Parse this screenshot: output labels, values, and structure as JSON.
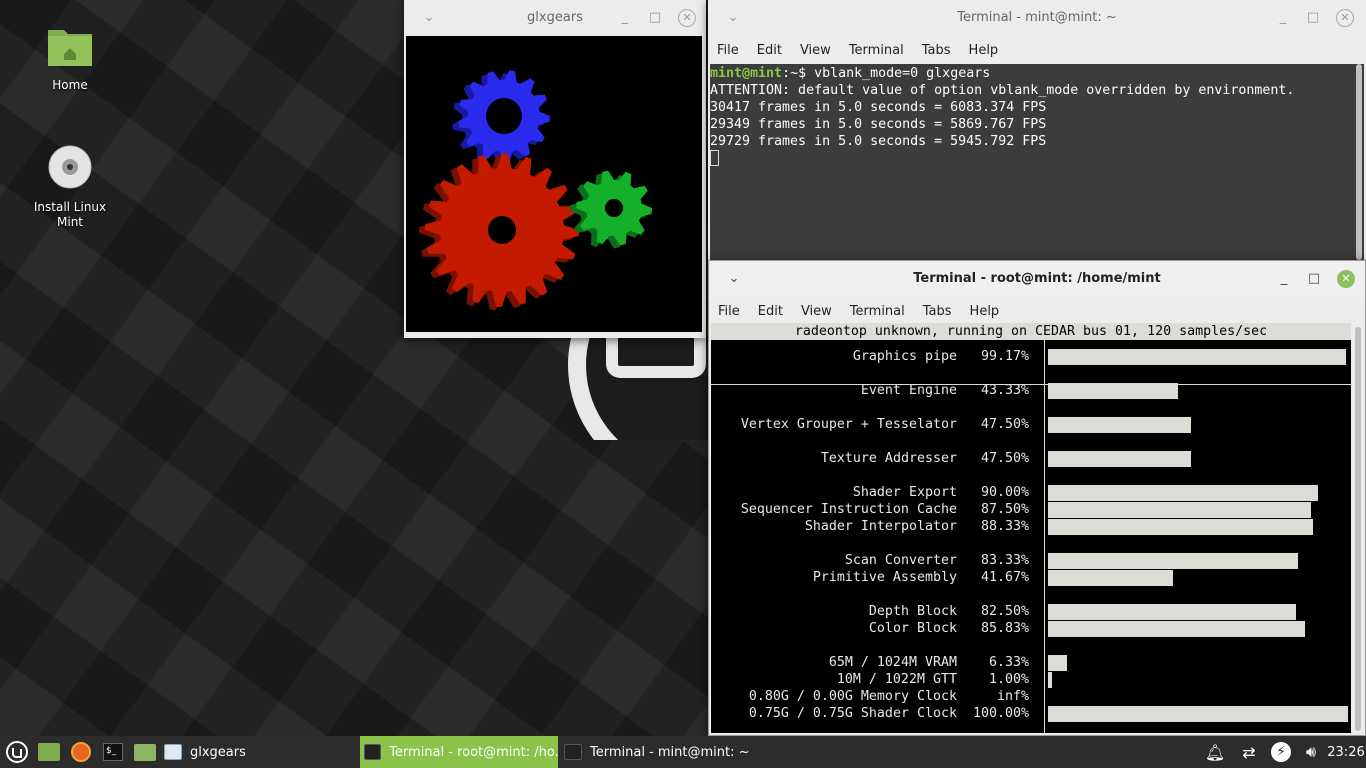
{
  "desktop": {
    "icons": [
      {
        "label": "Home",
        "icon": "home-folder-icon"
      },
      {
        "label": "Install Linux\nMint",
        "icon": "install-disc-icon"
      }
    ]
  },
  "glxgears": {
    "title": "glxgears",
    "gear_colors": {
      "red": "#c41a00",
      "green": "#15b02a",
      "blue": "#2b2bf0"
    }
  },
  "terminal_user": {
    "title": "Terminal - mint@mint: ~",
    "menu": [
      "File",
      "Edit",
      "View",
      "Terminal",
      "Tabs",
      "Help"
    ],
    "prompt_user": "mint@mint",
    "prompt_path": ":~$",
    "command": " vblank_mode=0 glxgears",
    "output": [
      "ATTENTION: default value of option vblank_mode overridden by environment.",
      "30417 frames in 5.0 seconds = 6083.374 FPS",
      "29349 frames in 5.0 seconds = 5869.767 FPS",
      "29729 frames in 5.0 seconds = 5945.792 FPS"
    ]
  },
  "terminal_root": {
    "title": "Terminal - root@mint: /home/mint",
    "menu": [
      "File",
      "Edit",
      "View",
      "Terminal",
      "Tabs",
      "Help"
    ],
    "radeontop": {
      "header": "radeontop unknown, running on CEDAR bus 01, 120 samples/sec",
      "rows": [
        {
          "label": "Graphics pipe",
          "value": "99.17%",
          "pct": 99.17
        },
        {
          "label": "Event Engine",
          "value": "43.33%",
          "pct": 43.33
        },
        {
          "label": "Vertex Grouper + Tesselator",
          "value": "47.50%",
          "pct": 47.5
        },
        {
          "label": "Texture Addresser",
          "value": "47.50%",
          "pct": 47.5
        },
        {
          "label": "Shader Export",
          "value": "90.00%",
          "pct": 90.0
        },
        {
          "label": "Sequencer Instruction Cache",
          "value": "87.50%",
          "pct": 87.5
        },
        {
          "label": "Shader Interpolator",
          "value": "88.33%",
          "pct": 88.33
        },
        {
          "label": "Scan Converter",
          "value": "83.33%",
          "pct": 83.33
        },
        {
          "label": "Primitive Assembly",
          "value": "41.67%",
          "pct": 41.67
        },
        {
          "label": "Depth Block",
          "value": "82.50%",
          "pct": 82.5
        },
        {
          "label": "Color Block",
          "value": "85.83%",
          "pct": 85.83
        },
        {
          "label": "65M / 1024M VRAM",
          "value": "6.33%",
          "pct": 6.33
        },
        {
          "label": "10M / 1022M GTT",
          "value": "1.00%",
          "pct": 1.0
        },
        {
          "label": "0.80G / 0.00G Memory Clock",
          "value": "inf%",
          "pct": 0
        },
        {
          "label": "0.75G / 0.75G Shader Clock",
          "value": "100.00%",
          "pct": 100.0
        }
      ]
    }
  },
  "taskbar": {
    "windows": [
      {
        "label": "glxgears"
      },
      {
        "label": "Terminal - root@mint: /ho..."
      },
      {
        "label": "Terminal - mint@mint: ~"
      }
    ],
    "clock": "23:26",
    "accent": "#8bc34a"
  }
}
